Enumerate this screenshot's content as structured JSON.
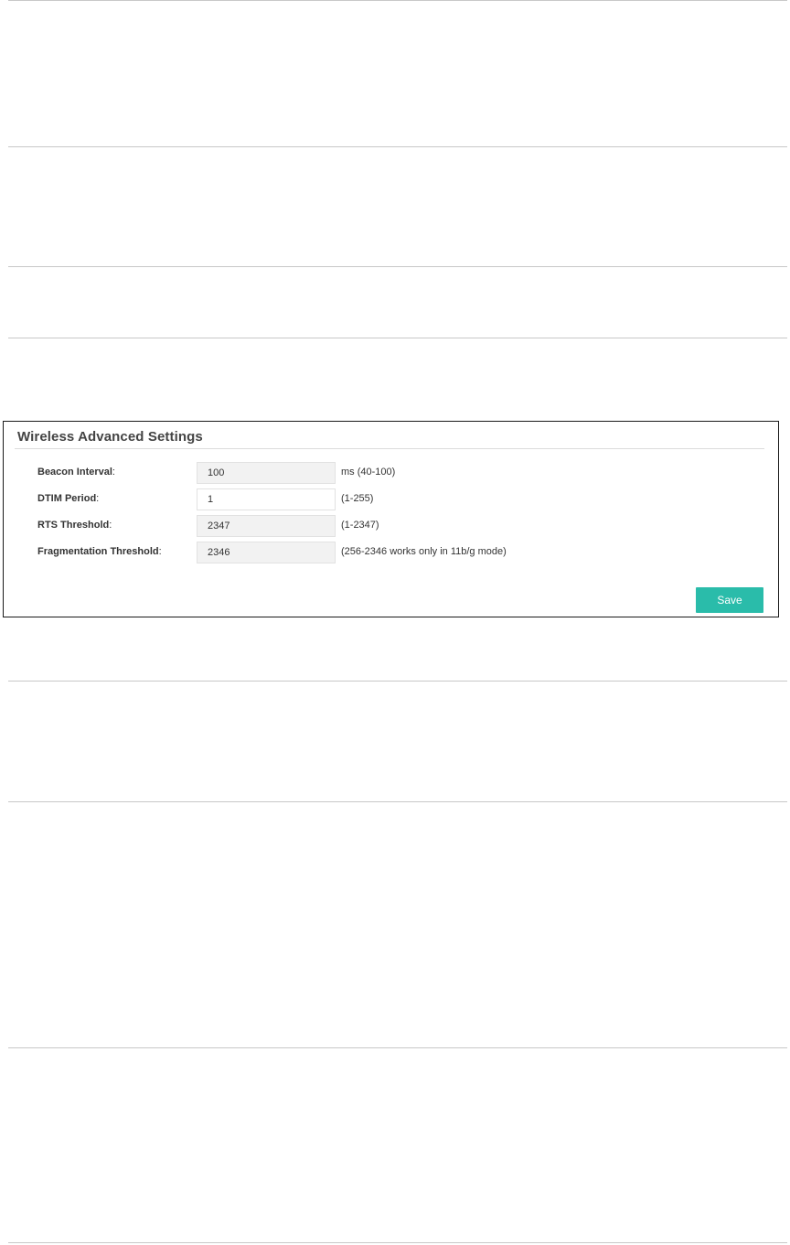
{
  "panel": {
    "title": "Wireless Advanced Settings",
    "fields": [
      {
        "label": "Beacon Interval",
        "value": "100",
        "hint": "ms (40-100)"
      },
      {
        "label": "DTIM Period",
        "value": "1",
        "hint": "(1-255)"
      },
      {
        "label": "RTS Threshold",
        "value": "2347",
        "hint": "(1-2347)"
      },
      {
        "label": "Fragmentation Threshold",
        "value": "2346",
        "hint": "(256-2346 works only in 11b/g mode)"
      }
    ],
    "save_label": "Save"
  },
  "colors": {
    "accent": "#2abcaa",
    "input_background": "#f2f2f2",
    "divider": "#c8c8c8"
  }
}
